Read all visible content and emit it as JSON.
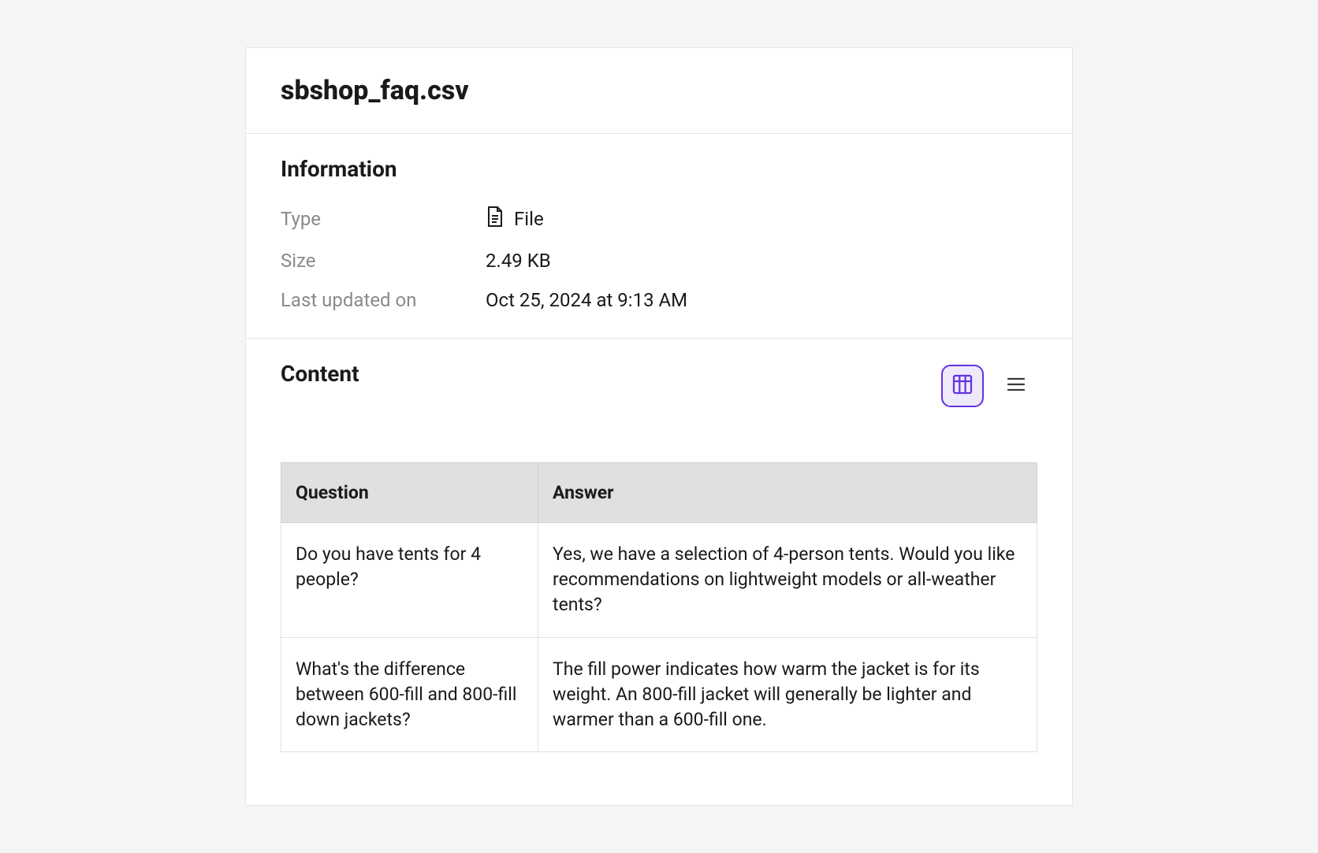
{
  "title": "sbshop_faq.csv",
  "information": {
    "heading": "Information",
    "fields": {
      "type_label": "Type",
      "type_value": "File",
      "size_label": "Size",
      "size_value": "2.49 KB",
      "updated_label": "Last updated on",
      "updated_value": "Oct 25, 2024 at 9:13 AM"
    }
  },
  "content": {
    "heading": "Content",
    "columns": {
      "question": "Question",
      "answer": "Answer"
    },
    "rows": [
      {
        "question": "Do you have tents for 4 people?",
        "answer": "Yes, we have a selection of 4-person tents. Would you like recommendations on lightweight models or all-weather tents?"
      },
      {
        "question": "What's the difference between 600-fill and 800-fill down jackets?",
        "answer": "The fill power indicates how warm the jacket is for its weight. An 800-fill jacket will generally be lighter and warmer than a 600-fill one."
      }
    ]
  }
}
